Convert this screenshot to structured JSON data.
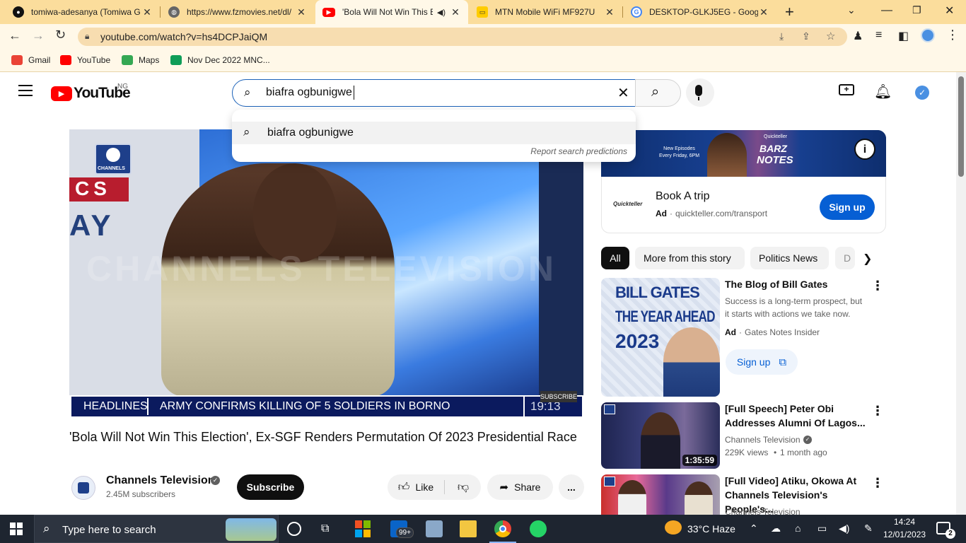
{
  "browser": {
    "tabs": [
      {
        "title": "tomiwa-adesanya (Tomiwa G",
        "icon": "github-icon"
      },
      {
        "title": "https://www.fzmovies.net/dl/",
        "icon": "globe-icon"
      },
      {
        "title": "'Bola Will Not Win This E",
        "icon": "youtube-icon",
        "active": true
      },
      {
        "title": "MTN Mobile WiFi MF927U",
        "icon": "mtn-icon"
      },
      {
        "title": "DESKTOP-GLKJ5EG - Google",
        "icon": "google-icon"
      }
    ],
    "new_tab_label": "+",
    "url": "youtube.com/watch?v=hs4DCPJaiQM",
    "bookmarks": [
      {
        "label": "Gmail",
        "color": "#ea4335"
      },
      {
        "label": "YouTube",
        "color": "#ff0000"
      },
      {
        "label": "Maps",
        "color": "#34a853"
      },
      {
        "label": "Nov Dec 2022 MNC...",
        "color": "#0f9d58"
      }
    ]
  },
  "youtube": {
    "logo_text": "YouTube",
    "country": "NG",
    "search": {
      "value": "biafra ogbunigwe",
      "suggestion": "biafra ogbunigwe",
      "report": "Report search predictions"
    }
  },
  "video": {
    "watermark": "CHANNELS TELEVISION",
    "logo_label": "CHANNELS",
    "backdrop_text_top": "CS",
    "backdrop_text_bottom": "AY",
    "ticker_label": "HEADLINES",
    "ticker_text": "ARMY CONFIRMS KILLING OF 5 SOLDIERS IN BORNO",
    "ticker_time": "19:13",
    "subscribe_watermark": "SUBSCRIBE",
    "title": "'Bola Will Not Win This Election', Ex-SGF Renders Permutation Of 2023 Presidential Race",
    "channel_name": "Channels Television",
    "subscribers": "2.45M subscribers",
    "subscribe_label": "Subscribe",
    "like_label": "Like",
    "share_label": "Share",
    "more_label": "..."
  },
  "ad": {
    "banner_small": "New Episodes\nEvery Friday, 6PM",
    "banner_brand_top": "BARZ",
    "banner_brand_bottom": "NOTES",
    "banner_sub": "Quickteller",
    "advertiser": "Quickteller",
    "title": "Book A trip",
    "ad_label": "Ad",
    "domain": "quickteller.com/transport",
    "cta": "Sign up"
  },
  "chips": [
    "All",
    "More from this story",
    "Politics News",
    "D"
  ],
  "related": [
    {
      "title": "The Blog of Bill Gates",
      "desc": "Success is a long-term prospect, but it starts with actions we take now.",
      "ad_label": "Ad",
      "advertiser": "Gates Notes Insider",
      "cta": "Sign up",
      "thumb_title_1": "BILL GATES",
      "thumb_title_2": "THE YEAR AHEAD",
      "thumb_title_3": "2023"
    },
    {
      "title": "[Full Speech] Peter Obi Addresses Alumni Of Lagos...",
      "channel": "Channels Television",
      "views": "229K views",
      "age": "1 month ago",
      "duration": "1:35:59"
    },
    {
      "title": "[Full Video] Atiku, Okowa At Channels Television's People's...",
      "channel": "Channels Television"
    }
  ],
  "taskbar": {
    "search_placeholder": "Type here to search",
    "badge": "99+",
    "weather": "33°C  Haze",
    "time": "14:24",
    "date": "12/01/2023",
    "notifications": "2"
  },
  "colors": {
    "chrome_tabbar": "#fbdd9c",
    "chrome_toolbar": "#fff8e8",
    "yt_red": "#ff0000",
    "signup_blue": "#065fd4",
    "ticker_navy": "#0b1a5e"
  }
}
